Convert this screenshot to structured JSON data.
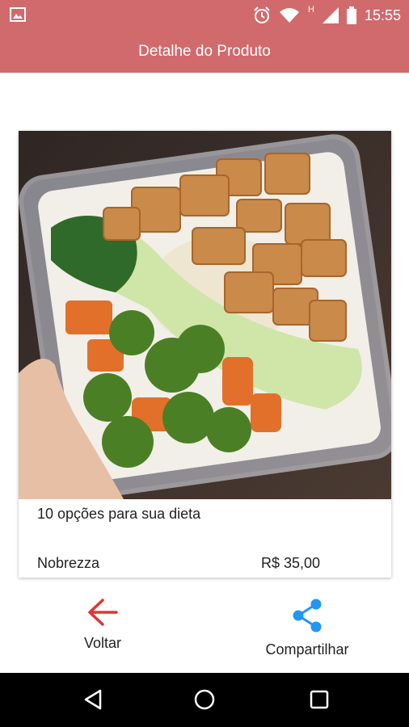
{
  "status_bar": {
    "time": "15:55",
    "network_label": "H",
    "icons": [
      "image-icon",
      "alarm-icon",
      "wifi-icon",
      "signal-icon",
      "battery-icon"
    ]
  },
  "app_bar": {
    "title": "Detalhe do Produto",
    "color": "#d16a6d"
  },
  "product": {
    "title": "10 opções para sua dieta",
    "store": "Nobrezza",
    "price": "R$ 35,00"
  },
  "actions": {
    "back_label": "Voltar",
    "back_color": "#e0352e",
    "share_label": "Compartilhar",
    "share_color": "#2196f3"
  },
  "nav_bar": {
    "icons": [
      "back-triangle-icon",
      "home-circle-icon",
      "recents-square-icon"
    ]
  }
}
